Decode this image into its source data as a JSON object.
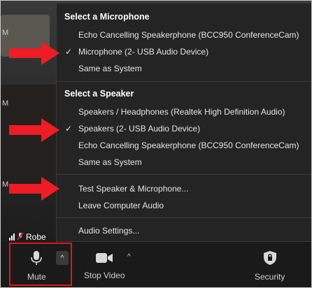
{
  "microphone_section": {
    "header": "Select a Microphone",
    "items": [
      {
        "label": "Echo Cancelling Speakerphone (BCC950 ConferenceCam)",
        "checked": false
      },
      {
        "label": "Microphone (2- USB Audio Device)",
        "checked": true
      },
      {
        "label": "Same as System",
        "checked": false
      }
    ]
  },
  "speaker_section": {
    "header": "Select a Speaker",
    "items": [
      {
        "label": "Speakers / Headphones (Realtek High Definition Audio)",
        "checked": false
      },
      {
        "label": "Speakers (2- USB Audio Device)",
        "checked": true
      },
      {
        "label": "Echo Cancelling Speakerphone (BCC950 ConferenceCam)",
        "checked": false
      },
      {
        "label": "Same as System",
        "checked": false
      }
    ]
  },
  "actions": {
    "test": "Test Speaker & Microphone...",
    "leave": "Leave Computer Audio",
    "settings": "Audio Settings..."
  },
  "check_glyph": "✓",
  "video": {
    "participant_name": "Robe",
    "edge_letters": [
      "M",
      "M",
      "M"
    ]
  },
  "toolbar": {
    "mute_label": "Mute",
    "stop_video_label": "Stop Video",
    "security_label": "Security",
    "caret_glyph": "^"
  },
  "colors": {
    "menu_bg": "#242424",
    "toolbar_bg": "#1a1a1a",
    "highlight_red": "#e4141b",
    "arrow_red": "#ee1c24"
  },
  "icons": {
    "mic": "microphone-icon",
    "video": "video-camera-icon",
    "security": "shield-icon",
    "muted": "muted-mic-icon",
    "audio_level": "audio-level-icon"
  }
}
